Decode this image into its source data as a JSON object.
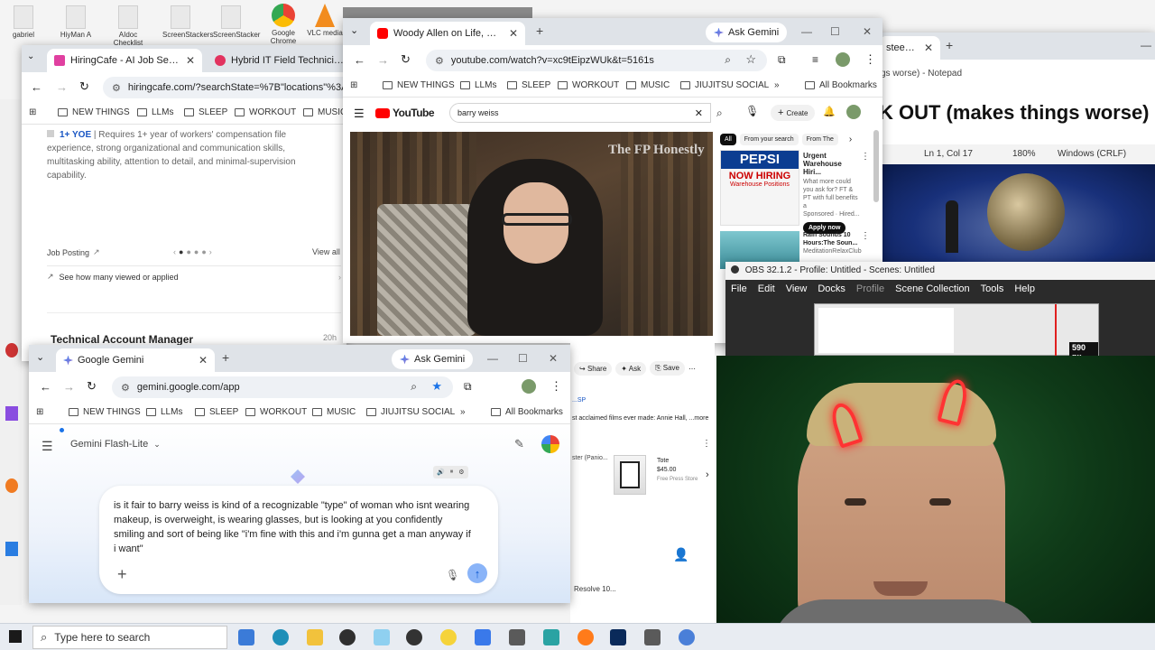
{
  "desktop": {
    "icons": [
      {
        "label": "gabriel"
      },
      {
        "label": "HiyMan A"
      },
      {
        "label": "AIdoc Checklist"
      },
      {
        "label": "ScreenStackers"
      },
      {
        "label": "ScreenStacker"
      },
      {
        "label": "Google Chrome"
      },
      {
        "label": "VLC media"
      }
    ]
  },
  "hiring_window": {
    "tabs": [
      {
        "label": "HiringCafe - AI Job Search",
        "color": "#e040a0"
      },
      {
        "label": "Hybrid IT Field Technician and I",
        "color": "#e2335f"
      }
    ],
    "url": "hiringcafe.com/?searchState=%7B\"locations\"%3A%5",
    "bookmarks": [
      "NEW THINGS",
      "LLMs",
      "SLEEP",
      "WORKOUT",
      "MUSIC"
    ],
    "job_tag": "1+ YOE",
    "job_desc": "Requires 1+ year of workers' compensation file experience, strong organizational and communication skills, multitasking ability, attention to detail, and minimal-supervision capability.",
    "job_posting_link": "Job Posting",
    "view_all": "View all",
    "see_viewed": "See how many viewed or applied",
    "next_job_title": "Technical Account Manager",
    "next_job_age": "20h"
  },
  "youtube_window": {
    "tab_label": "Woody Allen on Life, Death—an",
    "ask_gemini": "Ask Gemini",
    "url": "youtube.com/watch?v=xc9tEipzWUk&t=5161s",
    "bookmarks": [
      "NEW THINGS",
      "LLMs",
      "SLEEP",
      "WORKOUT",
      "MUSIC",
      "JIUJITSU SOCIAL"
    ],
    "all_bookmarks": "All Bookmarks",
    "logo_text": "YouTube",
    "search_query": "barry weiss",
    "create_label": "Create",
    "watermark": "The FP Honestly",
    "chips": [
      "All",
      "From your search",
      "From The"
    ],
    "ad": {
      "brand": "PEPSI",
      "headline": "NOW HIRING",
      "sub": "Warehouse Positions",
      "title": "Urgent Warehouse Hiri...",
      "desc": "What more could you ask for? FT & PT with full benefits a",
      "sponsored": "Sponsored · Hired...",
      "cta": "Apply now"
    },
    "rec": {
      "title": "Rain Sounds 10 Hours:The Soun...",
      "channel": "MeditationRelaxClub"
    },
    "actions": [
      "Share",
      "Ask",
      "Save"
    ],
    "desc_snippet": "st acclaimed films ever made: Annie Hall, ...more",
    "product": {
      "name": "Tote",
      "price": "$45.00",
      "store": "Free Press Store"
    },
    "product_left": "ster (Panio...",
    "bottom_text": "Resolve 10..."
  },
  "notepad_window": {
    "tab_label": "steen - Y",
    "title_fragment": "gs worse) - Notepad",
    "heading": "K OUT (makes things worse)",
    "status": {
      "position": "Ln 1, Col 17",
      "zoom": "180%",
      "line_ending": "Windows (CRLF)"
    }
  },
  "obs_window": {
    "title": "OBS 32.1.2 - Profile: Untitled - Scenes: Untitled",
    "menu": [
      "File",
      "Edit",
      "View",
      "Docks",
      "Profile",
      "Scene Collection",
      "Tools",
      "Help"
    ],
    "preview_label": "590 px"
  },
  "gemini_window": {
    "tab_label": "Google Gemini",
    "ask_gemini": "Ask Gemini",
    "url": "gemini.google.com/app",
    "bookmarks": [
      "NEW THINGS",
      "LLMs",
      "SLEEP",
      "WORKOUT",
      "MUSIC",
      "JIUJITSU SOCIAL"
    ],
    "all_bookmarks": "All Bookmarks",
    "model_label": "Gemini  Flash-Lite",
    "prompt_text": "is it fair to barry weiss is kind of a recognizable \"type\" of woman who isnt wearing makeup, is overweight, is wearing glasses, but is looking at you confidently smiling and sort of being like \"i'm fine with this and i'm gunna get a man anyway if i want\""
  },
  "taskbar": {
    "search_placeholder": "Type here to search"
  }
}
